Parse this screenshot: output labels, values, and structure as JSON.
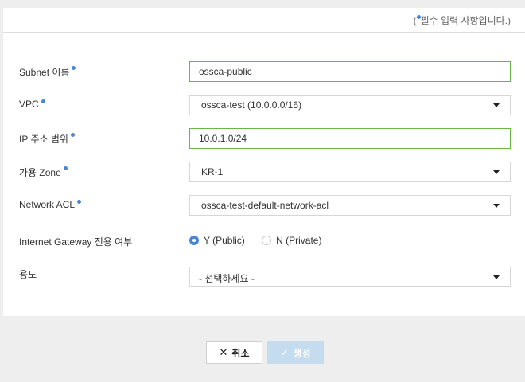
{
  "header": {
    "required_note_open": "(",
    "required_note_text": "필수 입력 사항입니다.)"
  },
  "form": {
    "subnet_name": {
      "label": "Subnet 이름",
      "value": "ossca-public"
    },
    "vpc": {
      "label": "VPC",
      "value": "ossca-test (10.0.0.0/16)"
    },
    "ip_range": {
      "label": "IP 주소 범위",
      "value": "10.0.1.0/24"
    },
    "zone": {
      "label": "가용 Zone",
      "value": "KR-1"
    },
    "network_acl": {
      "label": "Network ACL",
      "value": "ossca-test-default-network-acl"
    },
    "internet_gateway": {
      "label": "Internet Gateway 전용 여부",
      "options": [
        {
          "label": "Y (Public)",
          "selected": true
        },
        {
          "label": "N (Private)",
          "selected": false
        }
      ]
    },
    "purpose": {
      "label": "용도",
      "value": "- 선택하세요 -"
    }
  },
  "buttons": {
    "cancel_label": "취소",
    "create_label": "생성"
  },
  "colors": {
    "required_dot": "#4a86d6",
    "valid_border": "#68b845",
    "create_disabled": "#c5dcef"
  }
}
